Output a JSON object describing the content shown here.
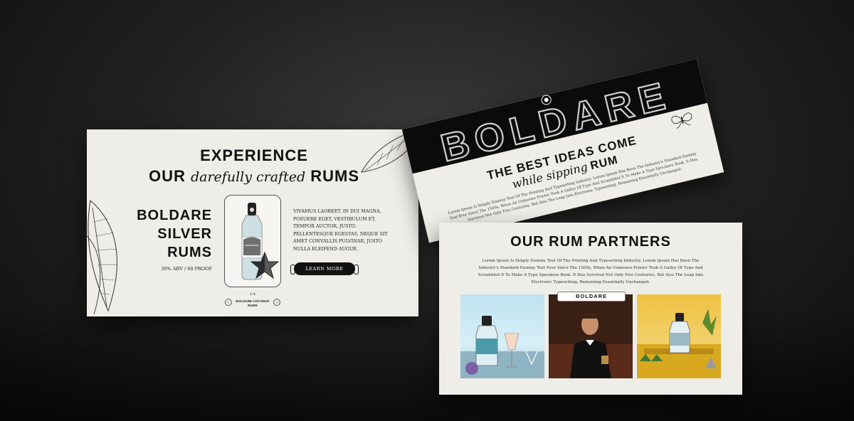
{
  "card1": {
    "title_line1": "EXPERIENCE",
    "title_line2_pre": "OUR",
    "title_line2_italic": "darefully crafted",
    "title_line2_post": "RUMS",
    "product_name_lines": [
      "BOLDARE",
      "SILVER",
      "RUMS"
    ],
    "abv": "30% ABV / 60 PROOF",
    "description": "VIVAMUS LAOREET. IN DUI MAGNA, POSUERE EGET, VESTIBULUM ET, TEMPOR AUCTOR, JUSTO. PELLENTESQUE EGESTAS, NEQUE SIT AMET CONVALLIS PULVINAR, JUSTO NULLA ELEIFEND AUGUE.",
    "learn_more": "LEARN MORE",
    "slide_counter": "1/4",
    "next_product": "BOLDARE COCONUT RUMS",
    "prev_arrow": "‹",
    "next_arrow": "›"
  },
  "card2": {
    "logo": "BOLDARE",
    "heading_line1": "THE BEST IDEAS COME",
    "heading_line2_italic": "while sipping",
    "heading_line2_bold": "RUM",
    "body": "Lorem Ipsum Is Simply Dummy Text Of The Printing And Typesetting Industry. Lorem Ipsum Has Been The Industry's Standard Dummy Text Ever Since The 1500s, When An Unknown Printer Took A Galley Of Type And Scrambled It To Make A Type Specimen Book. It Has Survived Not Only Five Centuries, But Also The Leap Into Electronic Typesetting, Remaining Essentially Unchanged."
  },
  "card3": {
    "title": "OUR RUM PARTNERS",
    "body": "Lorem Ipsum Is Simply Dummy Text Of The Printing And Typesetting Industry. Lorem Ipsum Has Been The Industry's Standard Dummy Text Ever Since The 1500s, When An Unknown Printer Took A Galley Of Type And Scrambled It To Make A Type Specimen Book. It Has Survived Not Only Five Centuries, But Also The Leap Into Electronic Typesetting, Remaining Essentially Unchanged.",
    "frame_label": "BOLDARE"
  },
  "colors": {
    "background": "#1c1c1c",
    "card": "#efede8",
    "ink": "#111111",
    "accent_dark": "#0b0b0b"
  },
  "icons": [
    "leaf-illustration",
    "butterfly-icon",
    "star-icon",
    "bottle-image",
    "circle-badge-icon"
  ]
}
